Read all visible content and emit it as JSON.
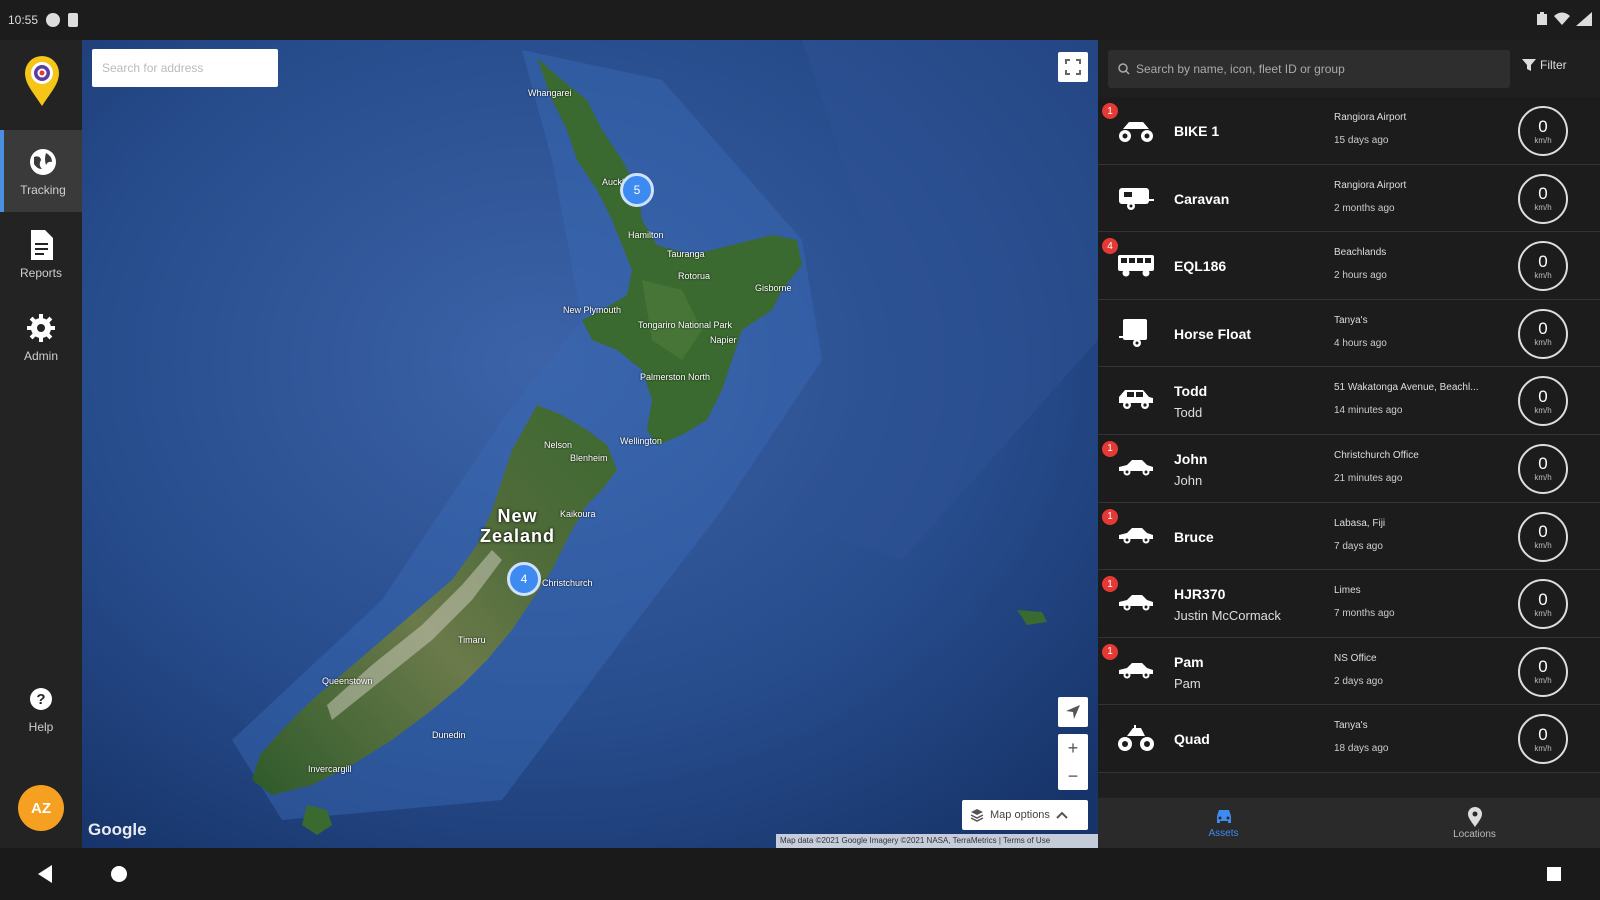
{
  "status_bar": {
    "time": "10:55"
  },
  "nav": {
    "items": [
      {
        "label": "Tracking",
        "icon": "globe-icon",
        "active": true
      },
      {
        "label": "Reports",
        "icon": "document-icon",
        "active": false
      },
      {
        "label": "Admin",
        "icon": "gear-icon",
        "active": false
      }
    ],
    "help_label": "Help",
    "avatar_initials": "AZ"
  },
  "map": {
    "search_placeholder": "Search for address",
    "country_label": "New\nZealand",
    "clusters": [
      {
        "count": "5"
      },
      {
        "count": "4"
      }
    ],
    "places": [
      "Auckland",
      "Hamilton",
      "Tauranga",
      "Rotorua",
      "Gisborne",
      "New Plymouth",
      "Tongariro National Park",
      "Napier",
      "Palmerston North",
      "Wellington",
      "Nelson",
      "Blenheim",
      "Kaikoura",
      "Christchurch",
      "Timaru",
      "Dunedin",
      "Queenstown",
      "Invercargill",
      "Whangarei"
    ],
    "map_options_label": "Map options",
    "google_label": "Google",
    "attribution": "Map data ©2021 Google Imagery ©2021 NASA, TerraMetrics | Terms of Use"
  },
  "panel": {
    "search_placeholder": "Search by name, icon, fleet ID or group",
    "filter_label": "Filter",
    "assets": [
      {
        "name": "BIKE 1",
        "sub": "",
        "location": "Rangiora Airport",
        "ago": "15 days ago",
        "km": "0",
        "unit": "km/h",
        "badge": "1",
        "icon": "atv-icon"
      },
      {
        "name": "Caravan",
        "sub": "",
        "location": "Rangiora Airport",
        "ago": "2 months ago",
        "km": "0",
        "unit": "km/h",
        "badge": "",
        "icon": "caravan-icon"
      },
      {
        "name": "EQL186",
        "sub": "",
        "location": "Beachlands",
        "ago": "2 hours ago",
        "km": "0",
        "unit": "km/h",
        "badge": "4",
        "icon": "bus-icon"
      },
      {
        "name": "Horse Float",
        "sub": "",
        "location": "Tanya's",
        "ago": "4 hours ago",
        "km": "0",
        "unit": "km/h",
        "badge": "",
        "icon": "trailer-icon"
      },
      {
        "name": "Todd",
        "sub": "Todd",
        "location": "51 Wakatonga Avenue, Beachl...",
        "ago": "14 minutes ago",
        "km": "0",
        "unit": "km/h",
        "badge": "",
        "icon": "suv-icon"
      },
      {
        "name": "John",
        "sub": "John",
        "location": "Christchurch Office",
        "ago": "21 minutes ago",
        "km": "0",
        "unit": "km/h",
        "badge": "1",
        "icon": "car-icon"
      },
      {
        "name": "Bruce",
        "sub": "",
        "location": "Labasa, Fiji",
        "ago": "7 days ago",
        "km": "0",
        "unit": "km/h",
        "badge": "1",
        "icon": "car-icon"
      },
      {
        "name": "HJR370",
        "sub": "Justin McCormack",
        "location": "Limes",
        "ago": "7 months ago",
        "km": "0",
        "unit": "km/h",
        "badge": "1",
        "icon": "car-icon"
      },
      {
        "name": "Pam",
        "sub": "Pam",
        "location": "NS Office",
        "ago": "2 days ago",
        "km": "0",
        "unit": "km/h",
        "badge": "1",
        "icon": "car-icon"
      },
      {
        "name": "Quad",
        "sub": "",
        "location": "Tanya's",
        "ago": "18 days ago",
        "km": "0",
        "unit": "km/h",
        "badge": "",
        "icon": "quad-icon"
      }
    ],
    "tabs": [
      {
        "label": "Assets",
        "icon": "vehicle-icon",
        "active": true
      },
      {
        "label": "Locations",
        "icon": "location-pin-icon",
        "active": false
      }
    ]
  }
}
